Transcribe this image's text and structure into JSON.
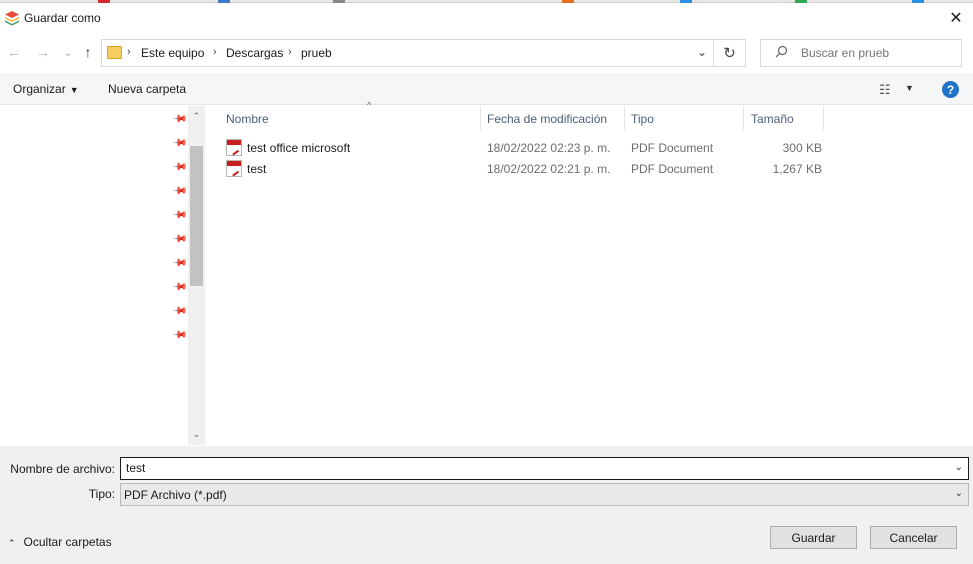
{
  "window": {
    "title": "Guardar como",
    "app_icon": "layers-stack-icon",
    "close_symbol": "✕"
  },
  "nav": {
    "back_symbol": "←",
    "forward_symbol": "→",
    "recent_symbol": "⌄",
    "up_symbol": "↑",
    "breadcrumb": [
      "Este equipo",
      "Descargas",
      "prueb"
    ],
    "refresh_symbol": "↻",
    "search_placeholder": "Buscar en prueb"
  },
  "toolbar": {
    "organize_label": "Organizar",
    "new_folder_label": "Nueva carpeta",
    "help_label": "?"
  },
  "columns": {
    "name": "Nombre",
    "date": "Fecha de modificación",
    "type": "Tipo",
    "size": "Tamaño"
  },
  "files": [
    {
      "name": "test office microsoft",
      "date": "18/02/2022 02:23 p. m.",
      "type": "PDF Document",
      "size": "300 KB"
    },
    {
      "name": "test",
      "date": "18/02/2022 02:21 p. m.",
      "type": "PDF Document",
      "size": "1,267 KB"
    }
  ],
  "save": {
    "filename_label": "Nombre de archivo:",
    "filename_value": "test",
    "type_label": "Tipo:",
    "type_value": "PDF Archivo (*.pdf)",
    "hide_folders_label": "Ocultar carpetas",
    "save_button": "Guardar",
    "cancel_button": "Cancelar"
  },
  "colors": {
    "accent": "#1e73c8",
    "pdf_red": "#c71e1e",
    "folder_yellow": "#f5cf5f"
  }
}
